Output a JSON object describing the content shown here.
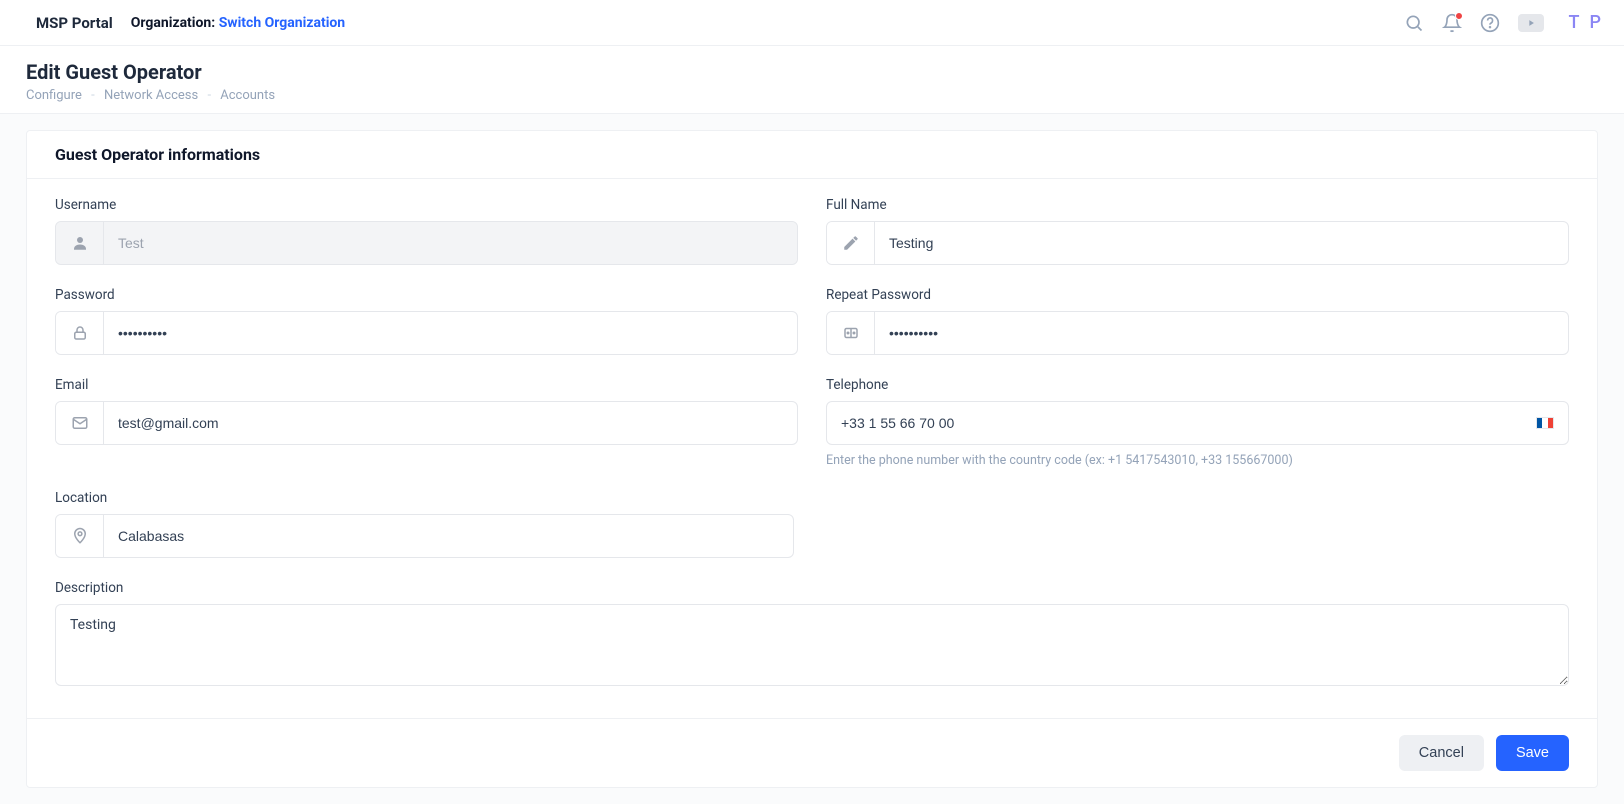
{
  "header": {
    "brand": "MSP Portal",
    "org_label": "Organization:",
    "org_switch": "Switch Organization",
    "avatar_initials": "T P"
  },
  "page": {
    "title": "Edit Guest Operator",
    "breadcrumb": [
      "Configure",
      "Network Access",
      "Accounts"
    ]
  },
  "section": {
    "title": "Guest Operator informations"
  },
  "form": {
    "username": {
      "label": "Username",
      "value": "Test"
    },
    "fullname": {
      "label": "Full Name",
      "value": "Testing"
    },
    "password": {
      "label": "Password",
      "value": "••••••••••"
    },
    "repeat_password": {
      "label": "Repeat Password",
      "value": "••••••••••"
    },
    "email": {
      "label": "Email",
      "value": "test@gmail.com"
    },
    "telephone": {
      "label": "Telephone",
      "value": "+33 1 55 66 70 00",
      "hint": "Enter the phone number with the country code (ex: +1 5417543010, +33 155667000)",
      "flag_colors": [
        "#0055A4",
        "#FFFFFF",
        "#EF4135"
      ]
    },
    "location": {
      "label": "Location",
      "value": "Calabasas"
    },
    "description": {
      "label": "Description",
      "value": "Testing"
    }
  },
  "actions": {
    "cancel": "Cancel",
    "save": "Save"
  }
}
